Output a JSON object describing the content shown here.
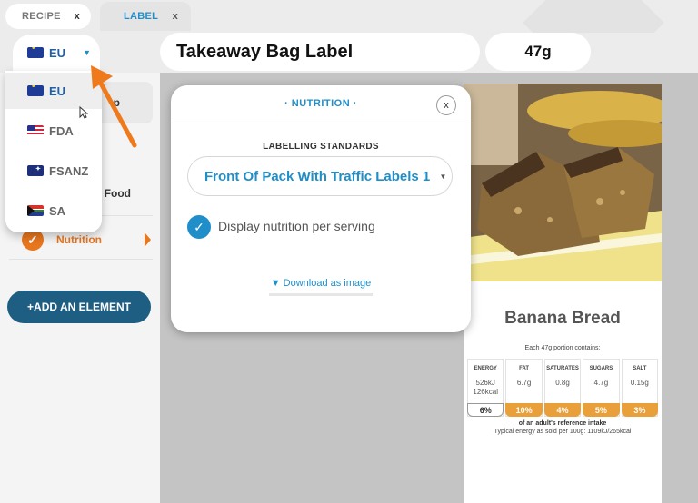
{
  "tabs": [
    {
      "label": "RECIPE",
      "close": "x"
    },
    {
      "label": "LABEL",
      "close": "x"
    }
  ],
  "region": {
    "selected": "EU",
    "caret": "▼"
  },
  "region_options": [
    {
      "code": "EU",
      "flag": "eu-flag-icon"
    },
    {
      "code": "FDA",
      "flag": "us-flag-icon"
    },
    {
      "code": "FSANZ",
      "flag": "au-flag-icon"
    },
    {
      "code": "SA",
      "flag": "za-flag-icon"
    }
  ],
  "header": {
    "title": "Takeaway Bag Label",
    "weight": "47g"
  },
  "sidebar": {
    "partial_item_1": "p",
    "partial_item_2": "Food",
    "nutrition_item": "Nutrition",
    "add_button": "+ADD AN ELEMENT"
  },
  "modal": {
    "title": "· NUTRITION ·",
    "close": "x",
    "standards_label": "LABELLING STANDARDS",
    "standard_selected": "Front Of Pack With Traffic Labels 1",
    "checkbox_label": "Display nutrition per serving",
    "download_link": "▼ Download as image"
  },
  "label": {
    "product_name": "Banana Bread",
    "portion_text": "Each 47g portion contains:",
    "nutrients": [
      {
        "name": "ENERGY",
        "value1": "526kJ",
        "value2": "126kcal",
        "percent": "6%"
      },
      {
        "name": "FAT",
        "value1": "6.7g",
        "value2": "",
        "percent": "10%"
      },
      {
        "name": "SATURATES",
        "value1": "0.8g",
        "value2": "",
        "percent": "4%"
      },
      {
        "name": "SUGARS",
        "value1": "4.7g",
        "value2": "",
        "percent": "5%"
      },
      {
        "name": "SALT",
        "value1": "0.15g",
        "value2": "",
        "percent": "3%"
      }
    ],
    "reference_note": "of an adult's reference intake",
    "typical_energy": "Typical energy as sold per 100g: 1109kJ/265kcal"
  },
  "colors": {
    "accent_blue": "#1f8ec9",
    "accent_orange": "#e8761f",
    "button_navy": "#1d5e82",
    "traffic_amber": "#eaa03a"
  }
}
